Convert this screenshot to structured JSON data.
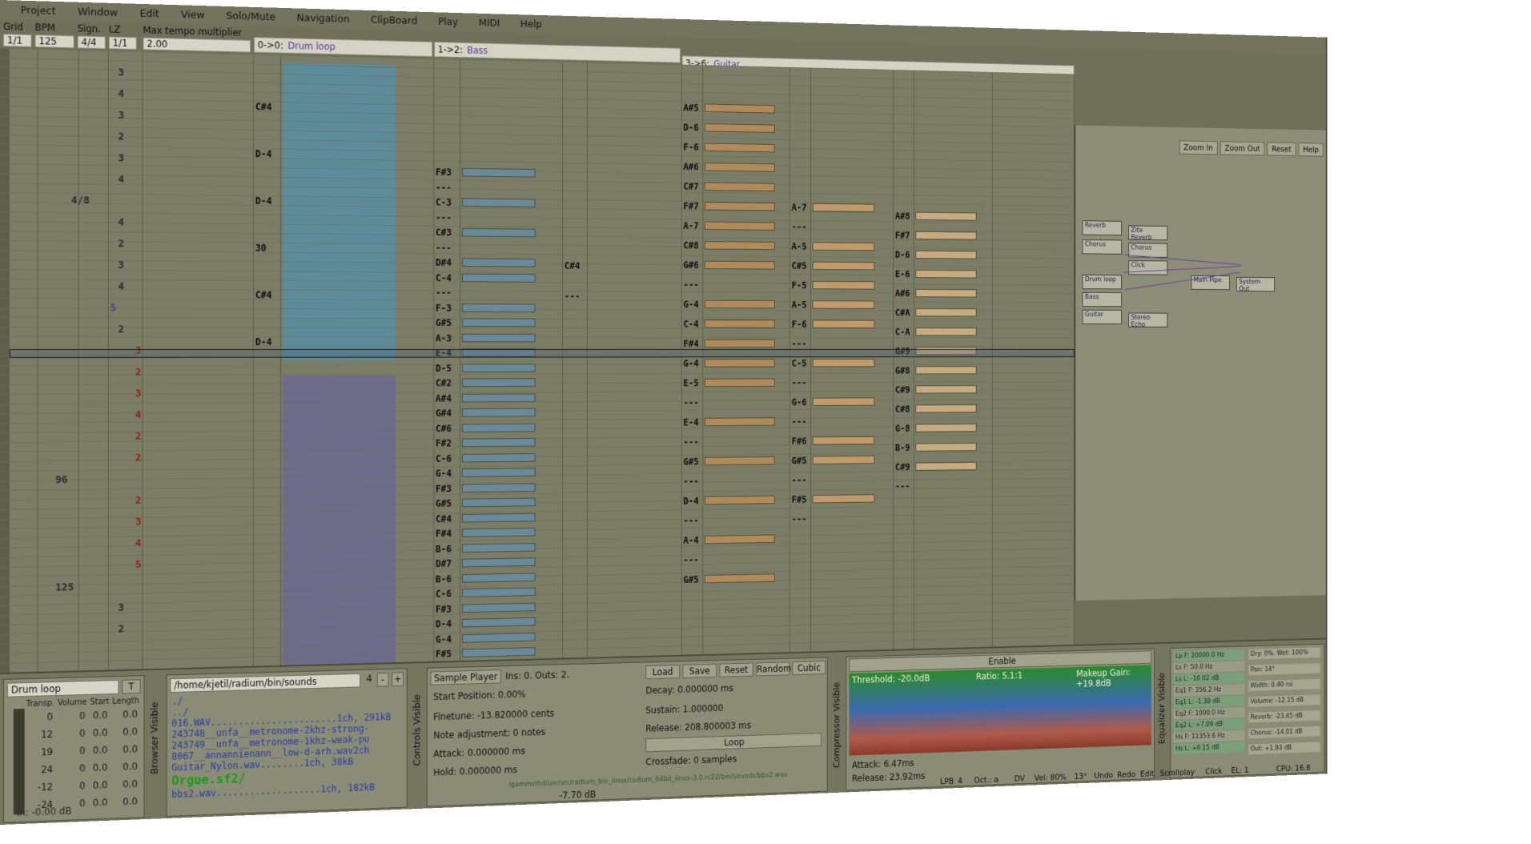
{
  "menu": [
    "Project",
    "Window",
    "Edit",
    "View",
    "Solo/Mute",
    "Navigation",
    "ClipBoard",
    "Play",
    "MIDI",
    "Help"
  ],
  "header": {
    "grid_label": "Grid",
    "grid_value": "1/1",
    "bpm_label": "BPM",
    "bpm_value": "125",
    "sign_label": "Sign.",
    "sign_value": "4/4",
    "lz_label": "LZ",
    "lz_value": "1/1",
    "tempo_label": "Max tempo multiplier",
    "tempo_value": "2.00"
  },
  "tracks": [
    {
      "num": "0->0:",
      "name": "Drum loop"
    },
    {
      "num": "1->2:",
      "name": "Bass"
    },
    {
      "num": "3->6:",
      "name": "Guitar"
    }
  ],
  "timeline": {
    "beats": [
      "3",
      "4",
      "3",
      "2",
      "3",
      "4",
      "4/8",
      "4",
      "2",
      "3",
      "4",
      "5",
      "2",
      "3",
      "2",
      "3",
      "4",
      "2",
      "2",
      "96",
      "2",
      "3",
      "4",
      "5",
      "125",
      "3",
      "2"
    ],
    "drum_notes": [
      "C#4",
      "D-4",
      "D-4",
      "30",
      "C#4",
      "D-4"
    ],
    "bass_notes": [
      "F#3",
      "---",
      "C-3",
      "---",
      "C#3",
      "---",
      "D#4",
      "C-4",
      "---",
      "F-3",
      "G#5",
      "A-3",
      "E-4",
      "D-5",
      "C#2",
      "A#4",
      "G#4",
      "C#6",
      "F#2",
      "C-6",
      "G-4",
      "F#3",
      "G#5",
      "C#4",
      "F#4",
      "B-6",
      "D#7",
      "B-6",
      "C-6",
      "F#3",
      "D-4",
      "G-4",
      "F#5"
    ],
    "bass_notes_b": [
      "C#4",
      "---"
    ],
    "guitar_a_notes": [
      "A#5",
      "D-6",
      "F-6",
      "A#6",
      "C#7",
      "F#7",
      "A-7",
      "C#8",
      "G#6",
      "---",
      "G-4",
      "C-4",
      "F#4",
      "G-4",
      "E-5",
      "---",
      "E-4",
      "---",
      "G#5",
      "---",
      "D-4",
      "---",
      "A-4",
      "---",
      "G#5"
    ],
    "guitar_b_notes": [
      "A-7",
      "---",
      "A-5",
      "C#5",
      "F-5",
      "A-5",
      "F-6",
      "---",
      "C-5",
      "---",
      "G-6",
      "---",
      "F#6",
      "G#5",
      "---",
      "F#5",
      "---"
    ],
    "guitar_c_notes": [
      "A#8",
      "F#7",
      "D-6",
      "E-6",
      "A#6",
      "C#A",
      "C-A",
      "G#9",
      "G#8",
      "C#9",
      "C#8",
      "G-8",
      "B-9",
      "C#9",
      "---"
    ]
  },
  "mixer": {
    "buttons": [
      "Zoom In",
      "Zoom Out",
      "Reset",
      "Help"
    ],
    "modules": [
      "Reverb",
      "Chorus",
      "Zita Reverb",
      "Chorus",
      "Click",
      "Drum loop",
      "Bass",
      "Guitar",
      "Main Pipe",
      "Stereo Echo",
      "System Out"
    ]
  },
  "instrument": {
    "name": "Drum loop",
    "t_button": "T",
    "col_headers": [
      "Transp.",
      "Volume",
      "Start",
      "Length"
    ],
    "rows": [
      [
        "0",
        "0",
        "0.0",
        "0.0"
      ],
      [
        "12",
        "0",
        "0.0",
        "0.0"
      ],
      [
        "19",
        "0",
        "0.0",
        "0.0"
      ],
      [
        "24",
        "0",
        "0.0",
        "0.0"
      ],
      [
        "-12",
        "0",
        "0.0",
        "0.0"
      ],
      [
        "-24",
        "0",
        "0.0",
        "0.0"
      ]
    ],
    "in_level": "In: -0.00 dB"
  },
  "browser": {
    "label": "Browser Visible",
    "path": "/home/kjetil/radium/bin/sounds",
    "count": "4",
    "files": [
      "./",
      "../",
      "016.WAV.......................1ch, 291kB",
      "243748__unfa__metronome-2khz-strong-",
      "243749__unfa__metronome-1khz-weak-pu",
      "8067__annannienann__low-d-arh.wav2ch",
      "Guitar_Nylon.wav........1ch, 38kB"
    ],
    "highlight": "Orgue.sf2/",
    "last": "bbs2.wav...................1ch, 182kB"
  },
  "sampler": {
    "controls_label": "Controls Visible",
    "title": "Sample Player",
    "ins_outs": "Ins: 0. Outs: 2.",
    "start": "Start Position: 0.00%",
    "finetune": "Finetune: -13.820000 cents",
    "note_adj": "Note adjustment: 0 notes",
    "attack": "Attack: 0.000000 ms",
    "hold": "Hold: 0.000000 ms",
    "decay": "Decay: 0.000000 ms",
    "sustain": "Sustain: 1.000000",
    "release": "Release: 208.800003 ms",
    "loop": "Loop",
    "crossfade": "Crossfade: 0 samples",
    "buttons": [
      "Load",
      "Save",
      "Reset",
      "Random",
      "Cubic"
    ],
    "path": "/gammelhd/usr/src/radium_bin_linux/radium_64bit_linux-3.0.rc22/bin/sounds/bbs2.wav",
    "level": "-7.70 dB"
  },
  "compressor": {
    "label": "Compressor Visible",
    "enable": "Enable",
    "threshold": "Threshold: -20.0dB",
    "ratio": "Ratio: 5.1:1",
    "makeup": "Makeup Gain: +19.8dB",
    "attack": "Attack: 6.47ms",
    "release": "Release: 23.92ms"
  },
  "equalizer": {
    "label": "Equalizer Visible",
    "rows": [
      "Lp F: 20000.0 Hz",
      "Ls F: 50.0 Hz",
      "Ls L: -10.02 dB",
      "Eq1 F: 356.2 Hz",
      "Eq1 L: -1.38 dB",
      "Eq2 F: 1000.0 Hz",
      "Eq2 L: +7.09 dB",
      "Hs F: 11353.6 Hz",
      "Hs L: +6.15 dB"
    ],
    "right_rows": [
      "Dry: 0%. Wet: 100%",
      "Pan: 14°",
      "Width: 0.40 rsi",
      "Volume: -12.15 dB",
      "Reverb: -23.45 dB",
      "Chorus: -14.01 dB",
      "Out: +1.93 dB"
    ]
  },
  "statusbar": {
    "lpb_label": "LPB",
    "lpb": "4",
    "oct": "Oct.: a",
    "dv": "DV",
    "vel": "Vel: 80%",
    "angle": "13°",
    "undo": "Undo",
    "redo": "Redo",
    "edit": "Edit",
    "scrollplay": "Scrollplay",
    "click": "Click",
    "el": "EL: 1",
    "cpu": "CPU: 16.8"
  }
}
